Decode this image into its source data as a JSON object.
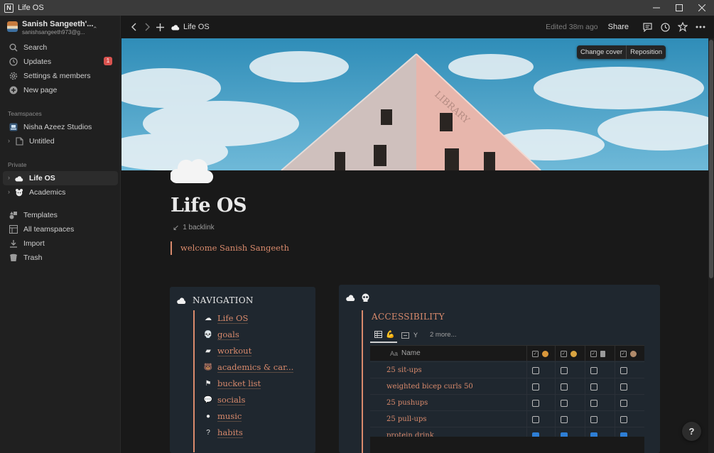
{
  "window": {
    "title": "Life OS",
    "app_icon": "N"
  },
  "sidebar": {
    "workspace": {
      "name": "Sanish Sangeeth'...",
      "email": "sanishsangeeth973@g..."
    },
    "actions": [
      {
        "label": "Search",
        "icon": "search-icon"
      },
      {
        "label": "Updates",
        "icon": "clock-icon",
        "badge": "1"
      },
      {
        "label": "Settings & members",
        "icon": "gear-icon"
      },
      {
        "label": "New page",
        "icon": "plus-circle-icon"
      }
    ],
    "teamspaces_heading": "Teamspaces",
    "teamspaces": [
      {
        "label": "Nisha Azeez Studios",
        "icon": "laptop-icon"
      },
      {
        "label": "Untitled",
        "icon": "page-icon"
      }
    ],
    "private_heading": "Private",
    "private": [
      {
        "label": "Life OS",
        "icon": "cloud-icon",
        "active": true
      },
      {
        "label": "Academics",
        "icon": "bear-icon"
      }
    ],
    "bottom": [
      {
        "label": "Templates",
        "icon": "shapes-icon"
      },
      {
        "label": "All teamspaces",
        "icon": "grid-icon"
      },
      {
        "label": "Import",
        "icon": "download-icon"
      },
      {
        "label": "Trash",
        "icon": "trash-icon"
      }
    ]
  },
  "topbar": {
    "breadcrumb": "Life OS",
    "edited": "Edited 38m ago",
    "share": "Share"
  },
  "cover": {
    "change_label": "Change cover",
    "reposition_label": "Reposition",
    "sign_text": "LIBRARY"
  },
  "page": {
    "title": "Life OS",
    "backlinks": "1 backlink",
    "callout": "welcome Sanish Sangeeth"
  },
  "navigation": {
    "title": "NAVIGATION",
    "links": [
      {
        "label": "Life OS",
        "icon": "cloud-icon",
        "glyph": "☁"
      },
      {
        "label": "goals",
        "icon": "skull-icon",
        "glyph": "💀"
      },
      {
        "label": "workout",
        "icon": "muscle-icon",
        "glyph": "▰"
      },
      {
        "label": "academics & car...",
        "icon": "bear-icon",
        "glyph": "🐻"
      },
      {
        "label": "bucket list",
        "icon": "flag-icon",
        "glyph": "⚑"
      },
      {
        "label": "socials",
        "icon": "chat-icon",
        "glyph": "💬"
      },
      {
        "label": "music",
        "icon": "circle-icon",
        "glyph": "●"
      },
      {
        "label": "habits",
        "icon": "question-icon",
        "glyph": "?"
      }
    ]
  },
  "accessibility": {
    "title": "ACCESSIBILITY",
    "more_views": "2 more...",
    "name_header": "Name",
    "name_header_prefix": "Aa",
    "rows": [
      {
        "name": "25 sit-ups",
        "checks": [
          false,
          false,
          false,
          false
        ]
      },
      {
        "name": "weighted bicep curls 50",
        "checks": [
          false,
          false,
          false,
          false
        ]
      },
      {
        "name": "25 pushups",
        "checks": [
          false,
          false,
          false,
          false
        ]
      },
      {
        "name": "25 pull-ups",
        "checks": [
          false,
          false,
          false,
          false
        ]
      },
      {
        "name": "protein drink",
        "checks": [
          true,
          true,
          true,
          true
        ]
      }
    ],
    "column_colors": [
      "#d9973a",
      "#d9a441",
      "#9a9a9a",
      "#b08a6a"
    ]
  },
  "help_label": "?"
}
